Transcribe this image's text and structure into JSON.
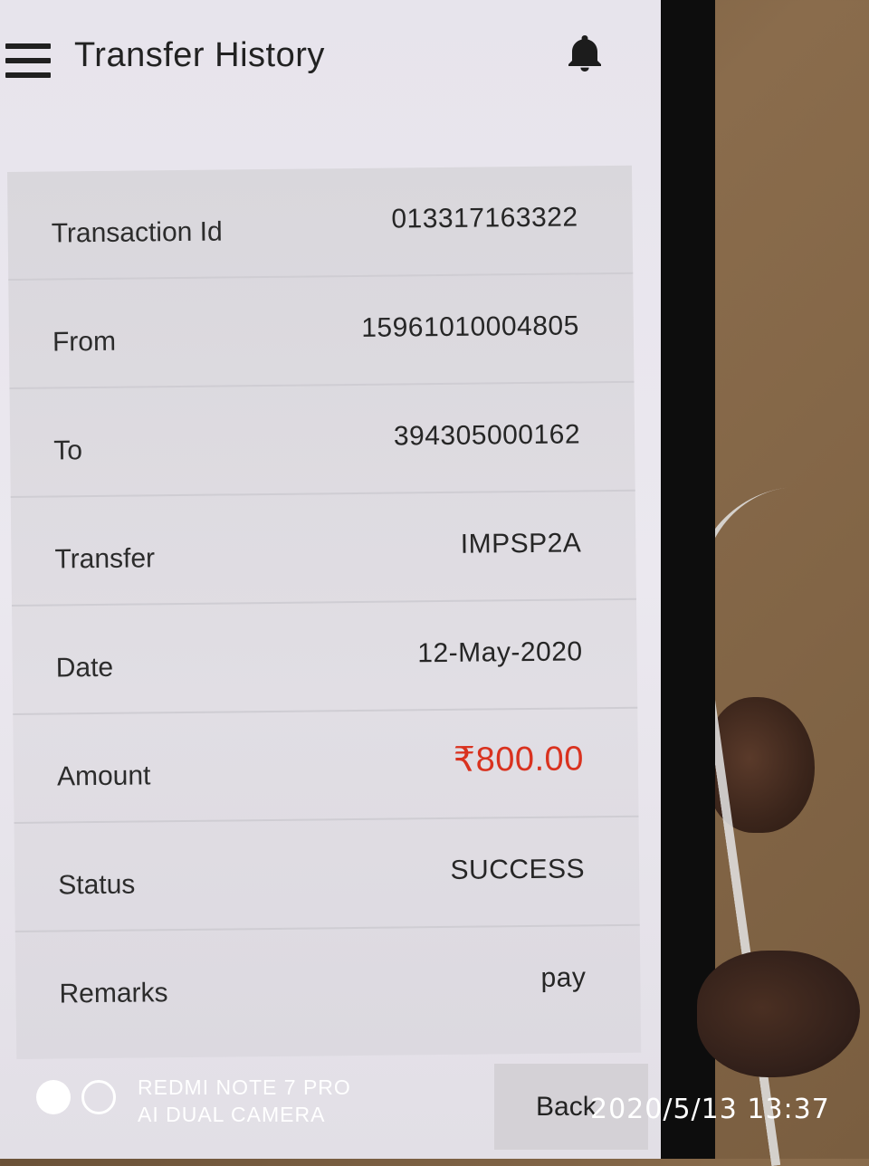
{
  "header": {
    "title": "Transfer History",
    "menu_icon": "hamburger-menu-icon",
    "notification_icon": "bell-icon"
  },
  "details": [
    {
      "label": "Transaction Id",
      "value": "013317163322"
    },
    {
      "label": "From",
      "value": "15961010004805"
    },
    {
      "label": "To",
      "value": "394305000162"
    },
    {
      "label": "Transfer",
      "value": "IMPSP2A"
    },
    {
      "label": "Date",
      "value": "12-May-2020"
    },
    {
      "label": "Amount",
      "value": "₹800.00"
    },
    {
      "label": "Status",
      "value": "SUCCESS"
    },
    {
      "label": "Remarks",
      "value": "pay"
    }
  ],
  "back_label": "Back",
  "camera_watermark": {
    "line1": "REDMI NOTE 7 PRO",
    "line2": "AI DUAL CAMERA",
    "timestamp": "2020/5/13  13:37"
  },
  "colors": {
    "amount": "#d9321f",
    "screen_bg": "#e7e4ec",
    "card_bg": "#dcd9e0"
  }
}
